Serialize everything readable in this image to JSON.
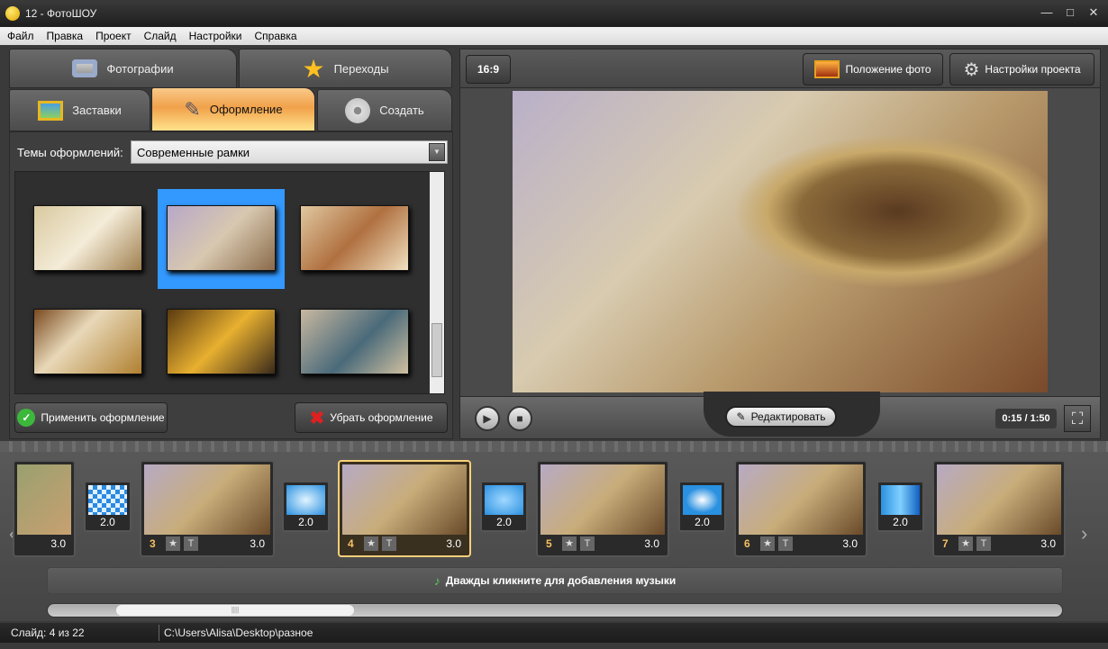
{
  "window": {
    "title": "12 - ФотоШОУ",
    "minimize": "—",
    "maximize": "□",
    "close": "✕"
  },
  "menu": [
    "Файл",
    "Правка",
    "Проект",
    "Слайд",
    "Настройки",
    "Справка"
  ],
  "tabs": {
    "photos": "Фотографии",
    "transitions": "Переходы",
    "screensavers": "Заставки",
    "design": "Оформление",
    "create": "Создать"
  },
  "design_panel": {
    "themes_label": "Темы оформлений:",
    "theme_selected": "Современные рамки",
    "apply": "Применить оформление",
    "remove": "Убрать оформление"
  },
  "preview": {
    "aspect": "16:9",
    "photo_position": "Положение фото",
    "project_settings": "Настройки проекта",
    "edit": "Редактировать",
    "time": "0:15 / 1:50"
  },
  "timeline": {
    "slides": [
      {
        "num": "",
        "dur": "3.0"
      },
      {
        "num": "3",
        "dur": "3.0"
      },
      {
        "num": "4",
        "dur": "3.0"
      },
      {
        "num": "5",
        "dur": "3.0"
      },
      {
        "num": "6",
        "dur": "3.0"
      },
      {
        "num": "7",
        "dur": "3.0"
      }
    ],
    "transitions": [
      "2.0",
      "2.0",
      "2.0",
      "2.0",
      "2.0"
    ],
    "music_hint": "Дважды кликните для добавления музыки",
    "star": "★",
    "text": "T"
  },
  "status": {
    "slide": "Слайд: 4 из 22",
    "path": "C:\\Users\\Alisa\\Desktop\\разное"
  }
}
